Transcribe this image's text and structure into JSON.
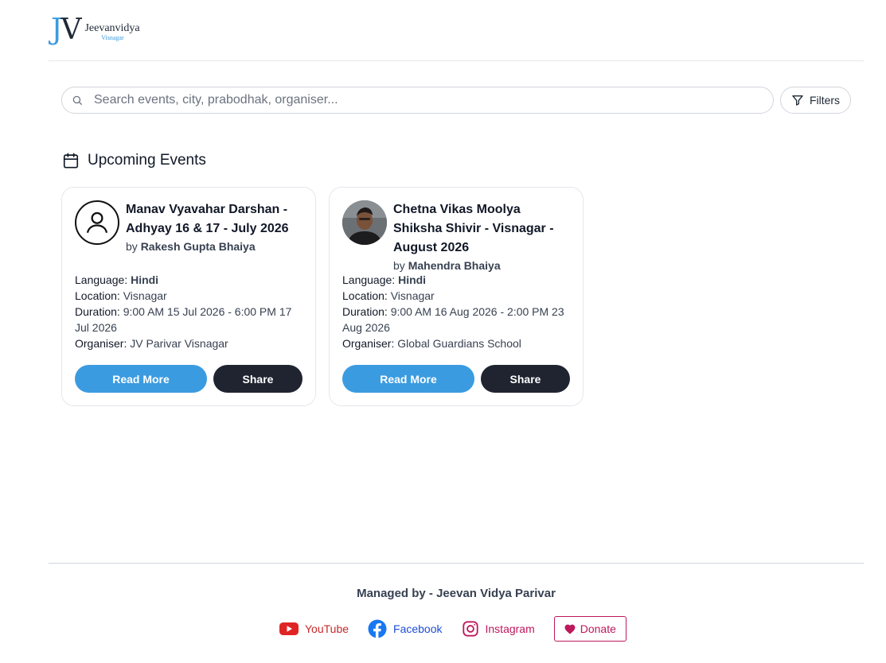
{
  "brand": {
    "mark_j": "J",
    "mark_v": "V",
    "name": "Jeevanvidya",
    "subtitle": "Visnagar"
  },
  "search": {
    "placeholder": "Search events, city, prabodhak, organiser...",
    "value": ""
  },
  "filters": {
    "label": "Filters"
  },
  "section": {
    "title": "Upcoming Events"
  },
  "events": [
    {
      "title": "Manav Vyavahar Darshan - Adhyay 16 & 17 - July 2026",
      "by_prefix": "by",
      "presenter": "Rakesh Gupta Bhaiya",
      "avatar": "default-user-icon",
      "language_label": "Language:",
      "language": "Hindi",
      "location_label": "Location:",
      "location": "Visnagar",
      "duration_label": "Duration:",
      "duration": "9:00 AM 15 Jul 2026 - 6:00 PM 17 Jul 2026",
      "organiser_label": "Organiser:",
      "organiser": "JV Parivar Visnagar",
      "read_more": "Read More",
      "share": "Share"
    },
    {
      "title": "Chetna Vikas Moolya Shiksha Shivir - Visnagar - August 2026",
      "by_prefix": "by",
      "presenter": "Mahendra Bhaiya",
      "avatar": "presenter-photo",
      "language_label": "Language:",
      "language": "Hindi",
      "location_label": "Location:",
      "location": "Visnagar",
      "duration_label": "Duration:",
      "duration": "9:00 AM 16 Aug 2026 - 2:00 PM 23 Aug 2026",
      "organiser_label": "Organiser:",
      "organiser": "Global Guardians School",
      "read_more": "Read More",
      "share": "Share"
    }
  ],
  "footer": {
    "managed_by": "Managed by - Jeevan Vidya Parivar",
    "youtube": "YouTube",
    "facebook": "Facebook",
    "instagram": "Instagram",
    "donate": "Donate"
  },
  "colors": {
    "accent": "#3b9be0",
    "dark_button": "#1f2430",
    "youtube": "#c62828",
    "facebook": "#1d4ed8",
    "instagram": "#be185d"
  }
}
